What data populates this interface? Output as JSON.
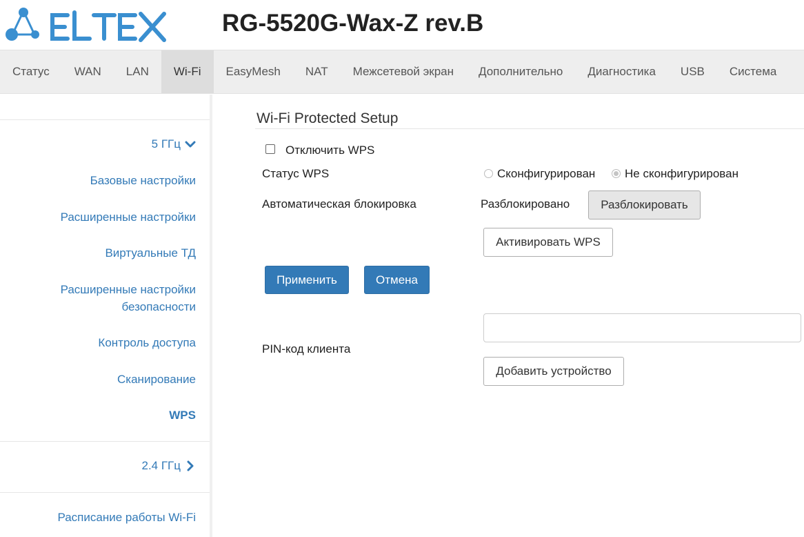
{
  "brand": {
    "logo_text": "ELTEX",
    "logo_color": "#3a8fd0"
  },
  "header": {
    "device_title": "RG-5520G-Wax-Z rev.B"
  },
  "topnav": {
    "items": [
      {
        "label": "Статус"
      },
      {
        "label": "WAN"
      },
      {
        "label": "LAN"
      },
      {
        "label": "Wi-Fi",
        "active": true
      },
      {
        "label": "EasyMesh"
      },
      {
        "label": "NAT"
      },
      {
        "label": "Межсетевой экран"
      },
      {
        "label": "Дополнительно"
      },
      {
        "label": "Диагностика"
      },
      {
        "label": "USB"
      },
      {
        "label": "Система"
      }
    ]
  },
  "sidebar": {
    "group_5ghz": {
      "label": "5 ГГц",
      "icon": "chevron-down-icon"
    },
    "items": [
      {
        "label": "Базовые настройки"
      },
      {
        "label": "Расширенные настройки"
      },
      {
        "label": "Виртуальные ТД"
      },
      {
        "label_line1": "Расширенные настройки",
        "label_line2": "безопасности"
      },
      {
        "label": "Контроль доступа"
      },
      {
        "label": "Сканирование"
      },
      {
        "label": "WPS",
        "active": true
      }
    ],
    "group_24ghz": {
      "label": "2.4 ГГц",
      "icon": "chevron-right-icon"
    },
    "schedule": {
      "label": "Расписание работы Wi-Fi"
    }
  },
  "wps": {
    "title": "Wi-Fi Protected Setup",
    "disable_wps_label": "Отключить WPS",
    "disable_wps_checked": false,
    "status_label": "Статус WPS",
    "status_options": [
      {
        "label": "Сконфигурирован",
        "checked": false
      },
      {
        "label": "Не сконфигурирован",
        "checked": true
      }
    ],
    "auto_lock_label": "Автоматическая блокировка",
    "auto_lock_value": "Разблокировано",
    "unlock_button": "Разблокировать",
    "activate_button": "Активировать WPS",
    "apply_button": "Применить",
    "cancel_button": "Отмена",
    "pin_label": "PIN-код клиента",
    "pin_value": "",
    "pin_placeholder": "",
    "add_device_button": "Добавить устройство"
  },
  "colors": {
    "accent": "#337ab7",
    "link": "#337ab7",
    "nav_bg": "#eeeeee",
    "nav_active_bg": "#dddddd"
  }
}
